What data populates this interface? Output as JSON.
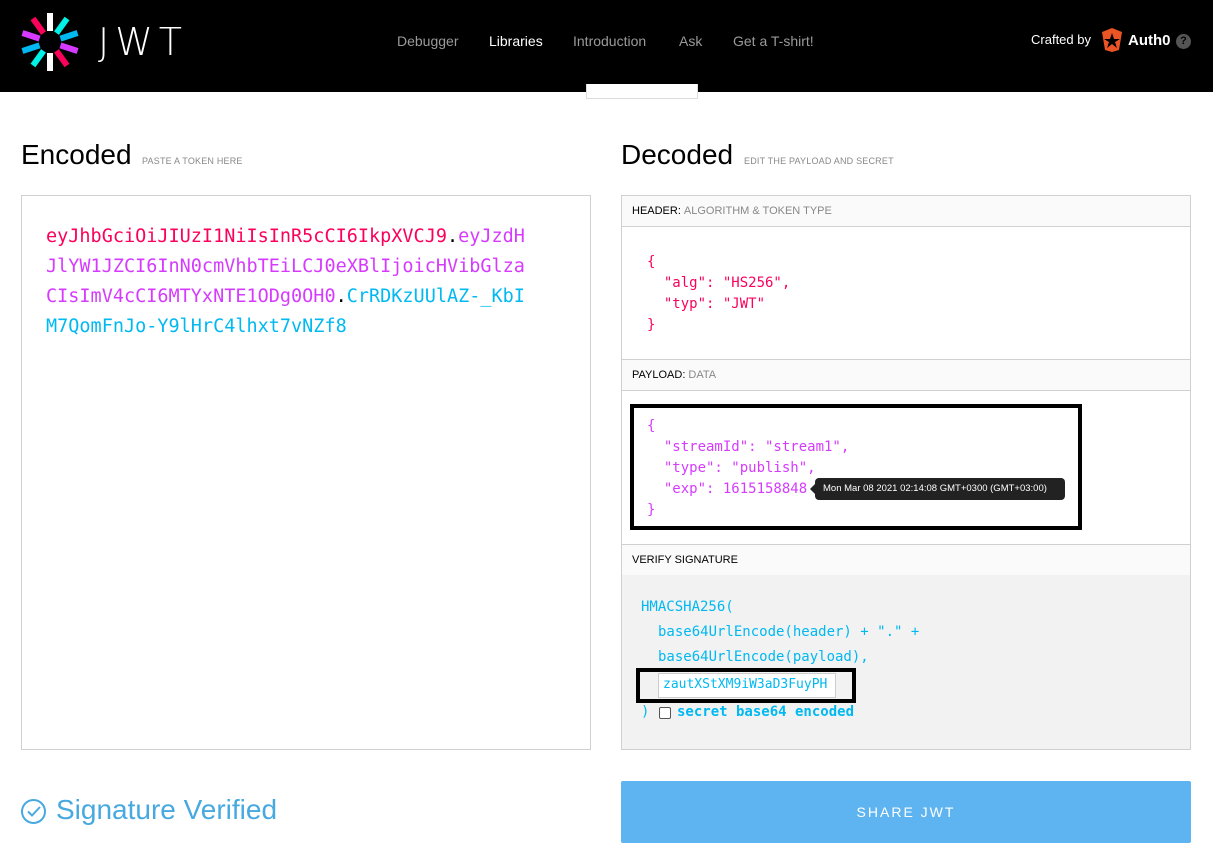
{
  "nav": {
    "logo_text": "JWT",
    "items": [
      "Debugger",
      "Libraries",
      "Introduction",
      "Ask",
      "Get a T-shirt!"
    ],
    "active": "Libraries",
    "crafted_by": "Crafted by",
    "brand": "Auth0",
    "help": "?"
  },
  "encoded": {
    "title": "Encoded",
    "subtitle": "PASTE A TOKEN HERE",
    "token_header": "eyJhbGciOiJIUzI1NiIsInR5cCI6IkpXVCJ9",
    "token_payload": "eyJzdHJlYW1JZCI6InN0cmVhbTEiLCJ0eXBlIjoicHVibGlzaCIsImV4cCI6MTYxNTE1ODg0OH0",
    "token_signature": "CrRDKzUUlAZ-_KbIM7QomFnJo-Y9lHrC4lhxt7vNZf8",
    "dot": "."
  },
  "decoded": {
    "title": "Decoded",
    "subtitle": "EDIT THE PAYLOAD AND SECRET",
    "header_label": "HEADER:",
    "header_desc": "ALGORITHM & TOKEN TYPE",
    "header_json": "{\n  \"alg\": \"HS256\",\n  \"typ\": \"JWT\"\n}",
    "payload_label": "PAYLOAD:",
    "payload_desc": "DATA",
    "payload_json": "{\n  \"streamId\": \"stream1\",\n  \"type\": \"publish\",\n  \"exp\": 1615158848\n}",
    "exp_tooltip": "Mon Mar 08 2021 02:14:08 GMT+0300 (GMT+03:00)",
    "verify_label": "VERIFY SIGNATURE",
    "verify_fn": "HMACSHA256(",
    "verify_line1": "base64UrlEncode(header) + \".\" +",
    "verify_line2": "base64UrlEncode(payload),",
    "secret_value": "zautXStXM9iW3aD3FuyPH",
    "close_paren": ")",
    "checkbox_label": "secret base64 encoded"
  },
  "status": {
    "verified_text": "Signature Verified"
  },
  "share_button": "SHARE JWT",
  "colors": {
    "header": "#fb015b",
    "payload": "#d63aff",
    "signature": "#00b9f1",
    "share": "#5eb4f0"
  }
}
